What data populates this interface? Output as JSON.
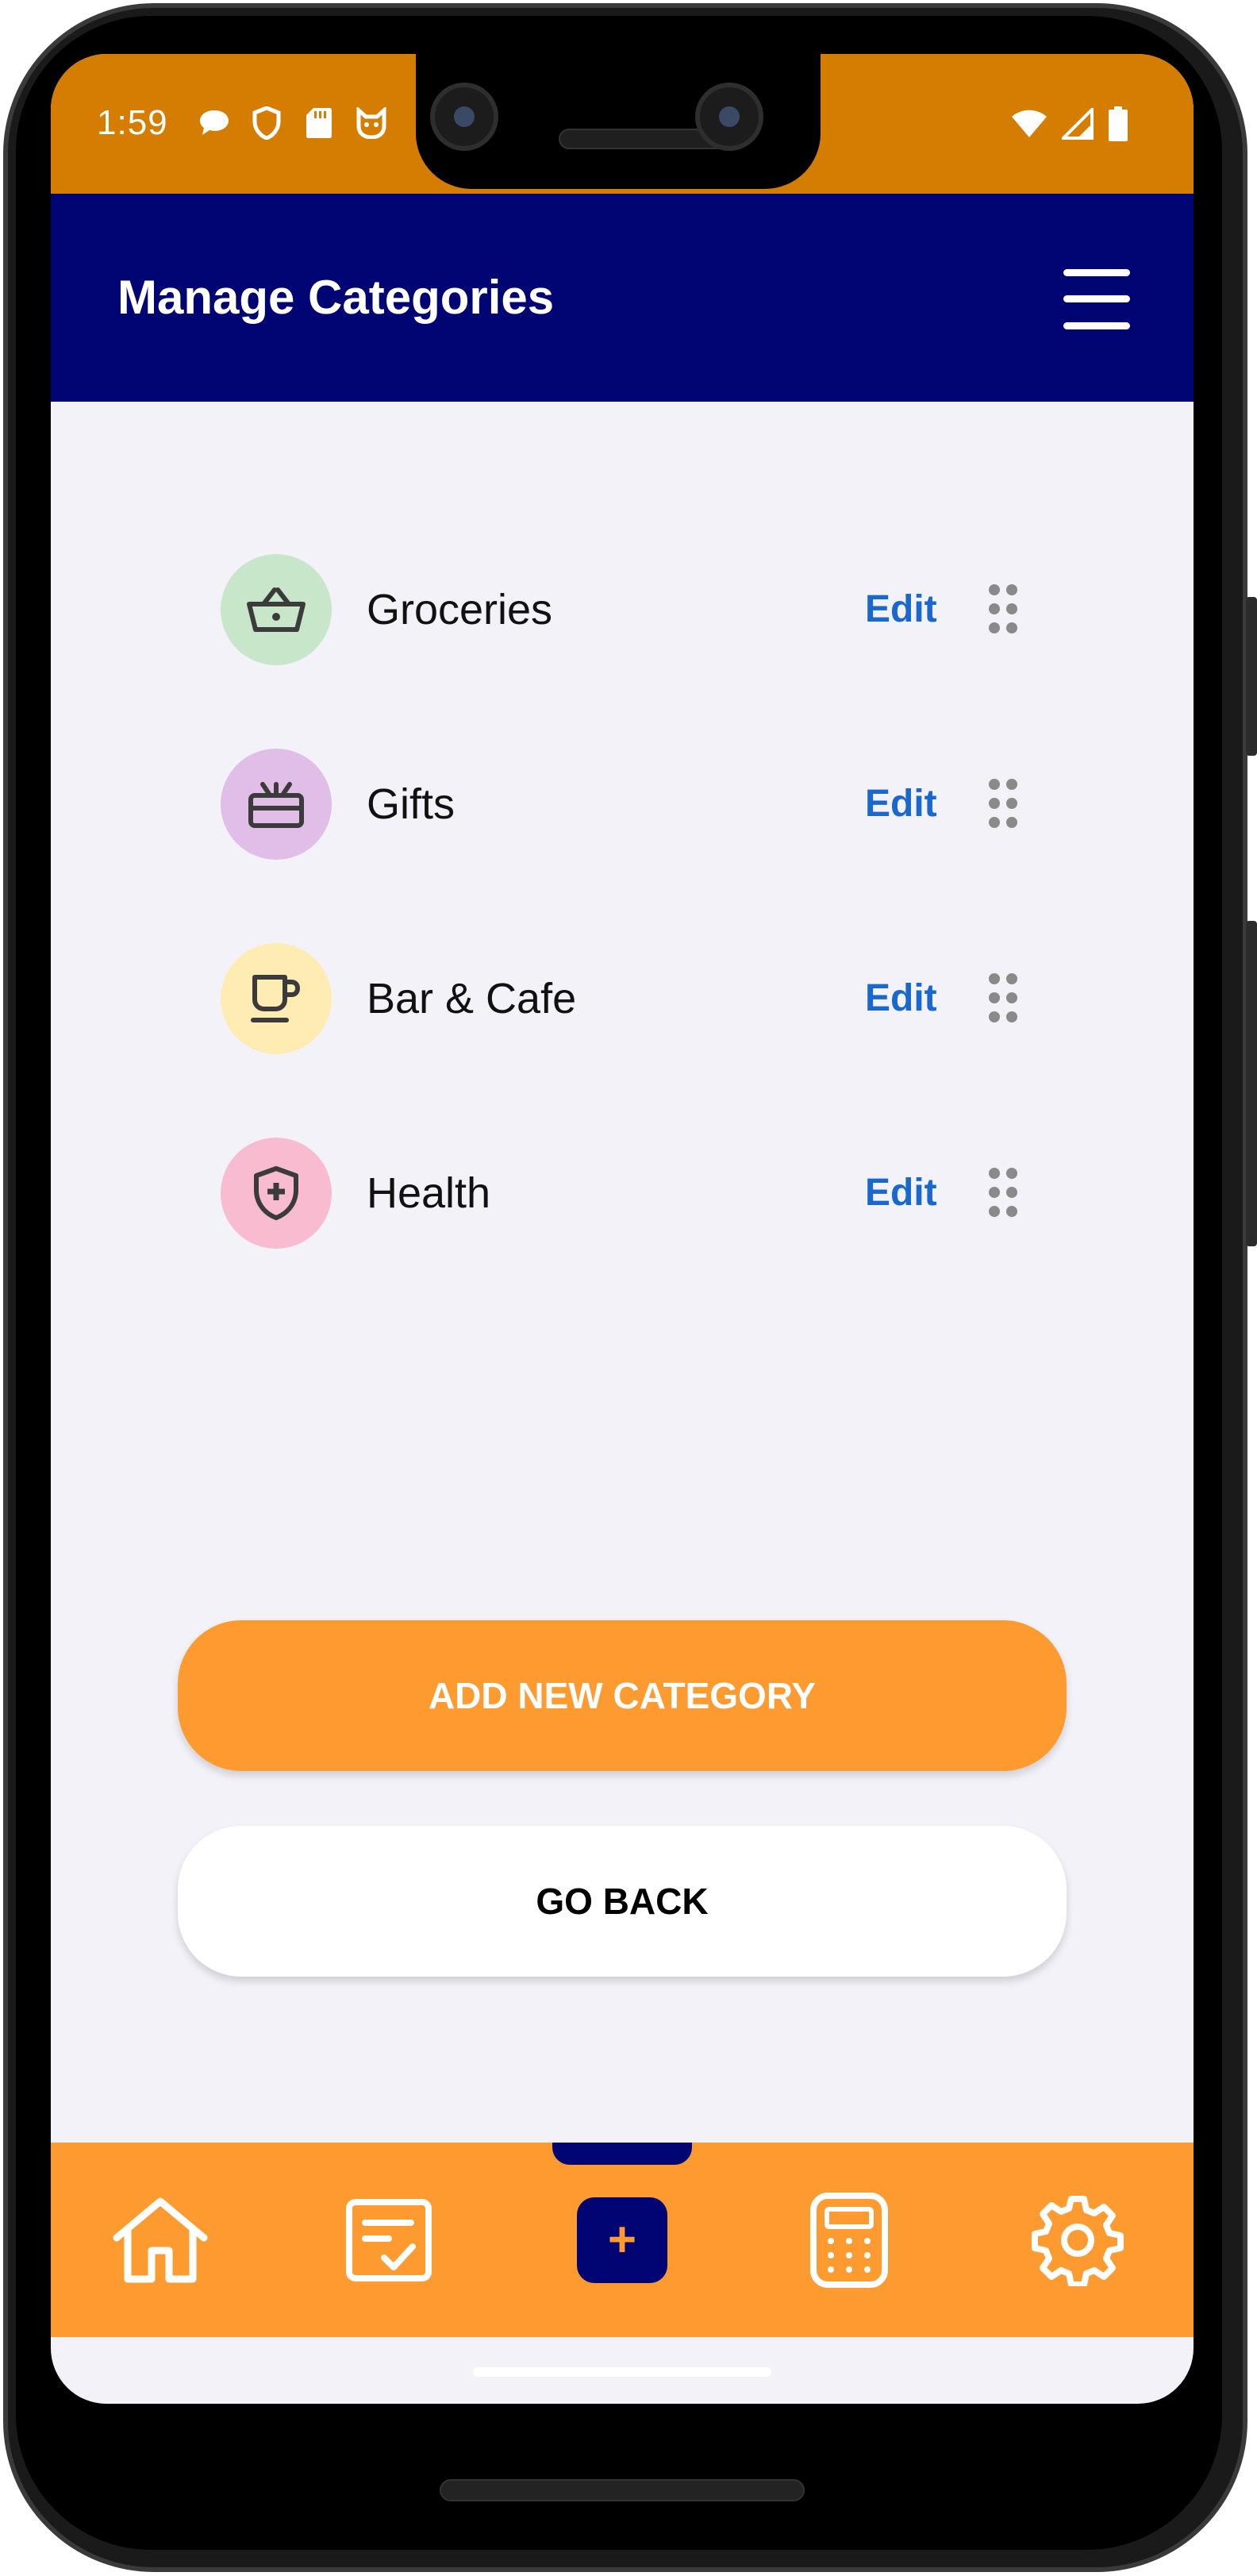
{
  "status_bar": {
    "time": "1:59",
    "left_icons": [
      "chat-bubble-icon",
      "shield-icon",
      "sd-card-icon",
      "cat-face-icon"
    ],
    "right_icons": [
      "wifi-icon",
      "signal-icon",
      "battery-icon"
    ],
    "color": "#d57d00"
  },
  "header": {
    "title": "Manage Categories",
    "menu_icon": "hamburger-menu-icon",
    "background": "#010573"
  },
  "categories": [
    {
      "label": "Groceries",
      "icon": "basket-icon",
      "icon_bg": "#c8e6c9",
      "edit_label": "Edit"
    },
    {
      "label": "Gifts",
      "icon": "gift-icon",
      "icon_bg": "#e1bee7",
      "edit_label": "Edit"
    },
    {
      "label": "Bar & Cafe",
      "icon": "coffee-cup-icon",
      "icon_bg": "#ffecb3",
      "edit_label": "Edit"
    },
    {
      "label": "Health",
      "icon": "health-shield-icon",
      "icon_bg": "#f8bbd0",
      "edit_label": "Edit"
    }
  ],
  "actions": {
    "add_label": "ADD NEW CATEGORY",
    "back_label": "GO BACK",
    "accent": "#fd9b31"
  },
  "bottom_nav": {
    "items": [
      "home-icon",
      "checklist-icon",
      "add-icon",
      "calculator-icon",
      "settings-gear-icon"
    ],
    "add_glyph": "+"
  }
}
